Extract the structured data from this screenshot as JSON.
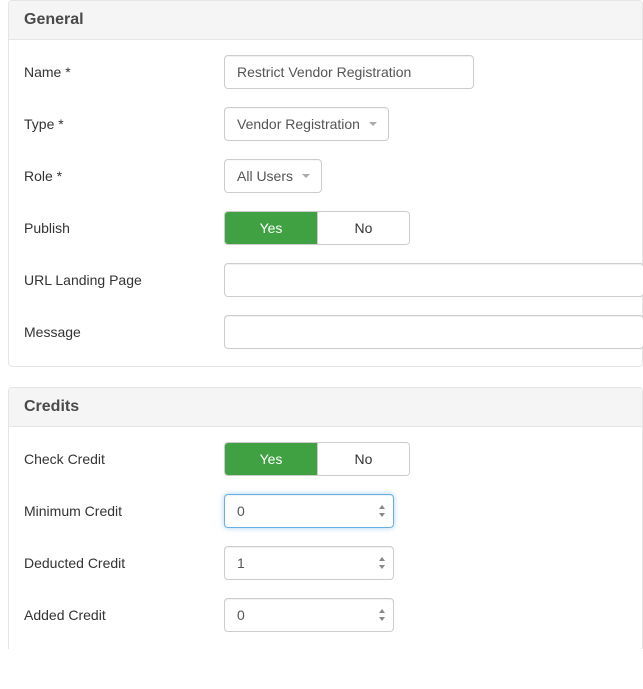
{
  "general": {
    "heading": "General",
    "name": {
      "label": "Name *",
      "value": "Restrict Vendor Registration"
    },
    "type": {
      "label": "Type *",
      "selected": "Vendor Registration"
    },
    "role": {
      "label": "Role *",
      "selected": "All Users"
    },
    "publish": {
      "label": "Publish",
      "yes": "Yes",
      "no": "No",
      "value": "Yes"
    },
    "url_landing": {
      "label": "URL Landing Page",
      "value": ""
    },
    "message": {
      "label": "Message",
      "value": ""
    }
  },
  "credits": {
    "heading": "Credits",
    "check_credit": {
      "label": "Check Credit",
      "yes": "Yes",
      "no": "No",
      "value": "Yes"
    },
    "minimum_credit": {
      "label": "Minimum Credit",
      "value": "0"
    },
    "deducted_credit": {
      "label": "Deducted Credit",
      "value": "1"
    },
    "added_credit": {
      "label": "Added Credit",
      "value": "0"
    }
  }
}
